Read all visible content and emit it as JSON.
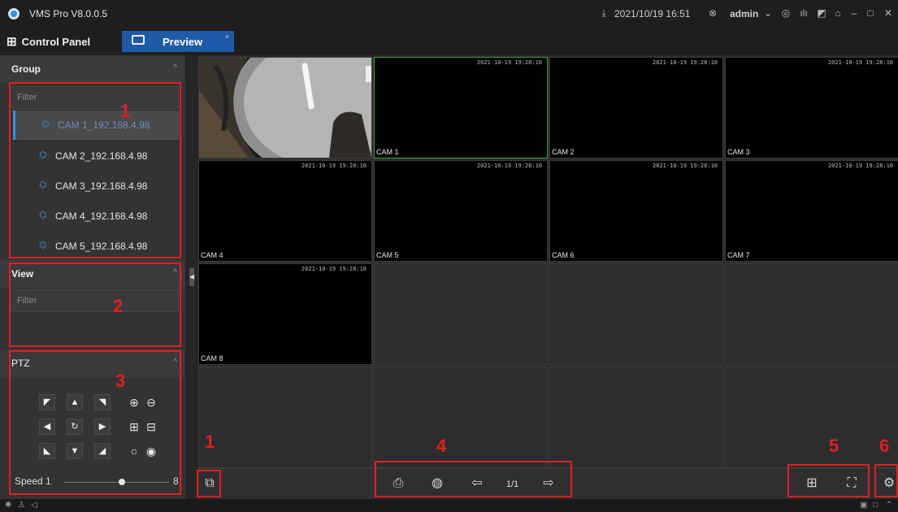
{
  "app": {
    "title": "VMS Pro V8.0.0.5",
    "datetime": "2021/10/19 16:51",
    "user": "admin"
  },
  "tabs": {
    "control_panel": "Control Panel",
    "preview": "Preview",
    "close_glyph": "×"
  },
  "sidebar": {
    "group": {
      "title": "Group",
      "filter_placeholder": "Filter",
      "cameras": [
        "CAM 1_192.168.4.98",
        "CAM 2_192.168.4.98",
        "CAM 3_192.168.4.98",
        "CAM 4_192.168.4.98",
        "CAM 5_192.168.4.98"
      ]
    },
    "view": {
      "title": "View",
      "filter_placeholder": "Filter"
    },
    "ptz": {
      "title": "PTZ",
      "speed_label": "Speed 1",
      "speed_max": "8",
      "speed_value": 0.55
    }
  },
  "grid": {
    "timestamp": "2021-10-19 19:28:10",
    "cells": [
      {
        "name": "",
        "video": true,
        "image": true
      },
      {
        "name": "CAM 1",
        "video": true,
        "active": true
      },
      {
        "name": "CAM 2",
        "video": true
      },
      {
        "name": "CAM 3",
        "video": true
      },
      {
        "name": "CAM 4",
        "video": true
      },
      {
        "name": "CAM 5",
        "video": true
      },
      {
        "name": "CAM 6",
        "video": true
      },
      {
        "name": "CAM 7",
        "video": true
      },
      {
        "name": "CAM 8",
        "video": true
      }
    ]
  },
  "toolbar": {
    "page": "1/1"
  },
  "annotations": {
    "n1": "1",
    "n2": "2",
    "n3": "3",
    "n1b": "1",
    "n4": "4",
    "n5": "5",
    "n6": "6"
  },
  "colors": {
    "accent": "#1e5aa7",
    "annotation": "#e02020",
    "active_border": "#3aa33a"
  }
}
